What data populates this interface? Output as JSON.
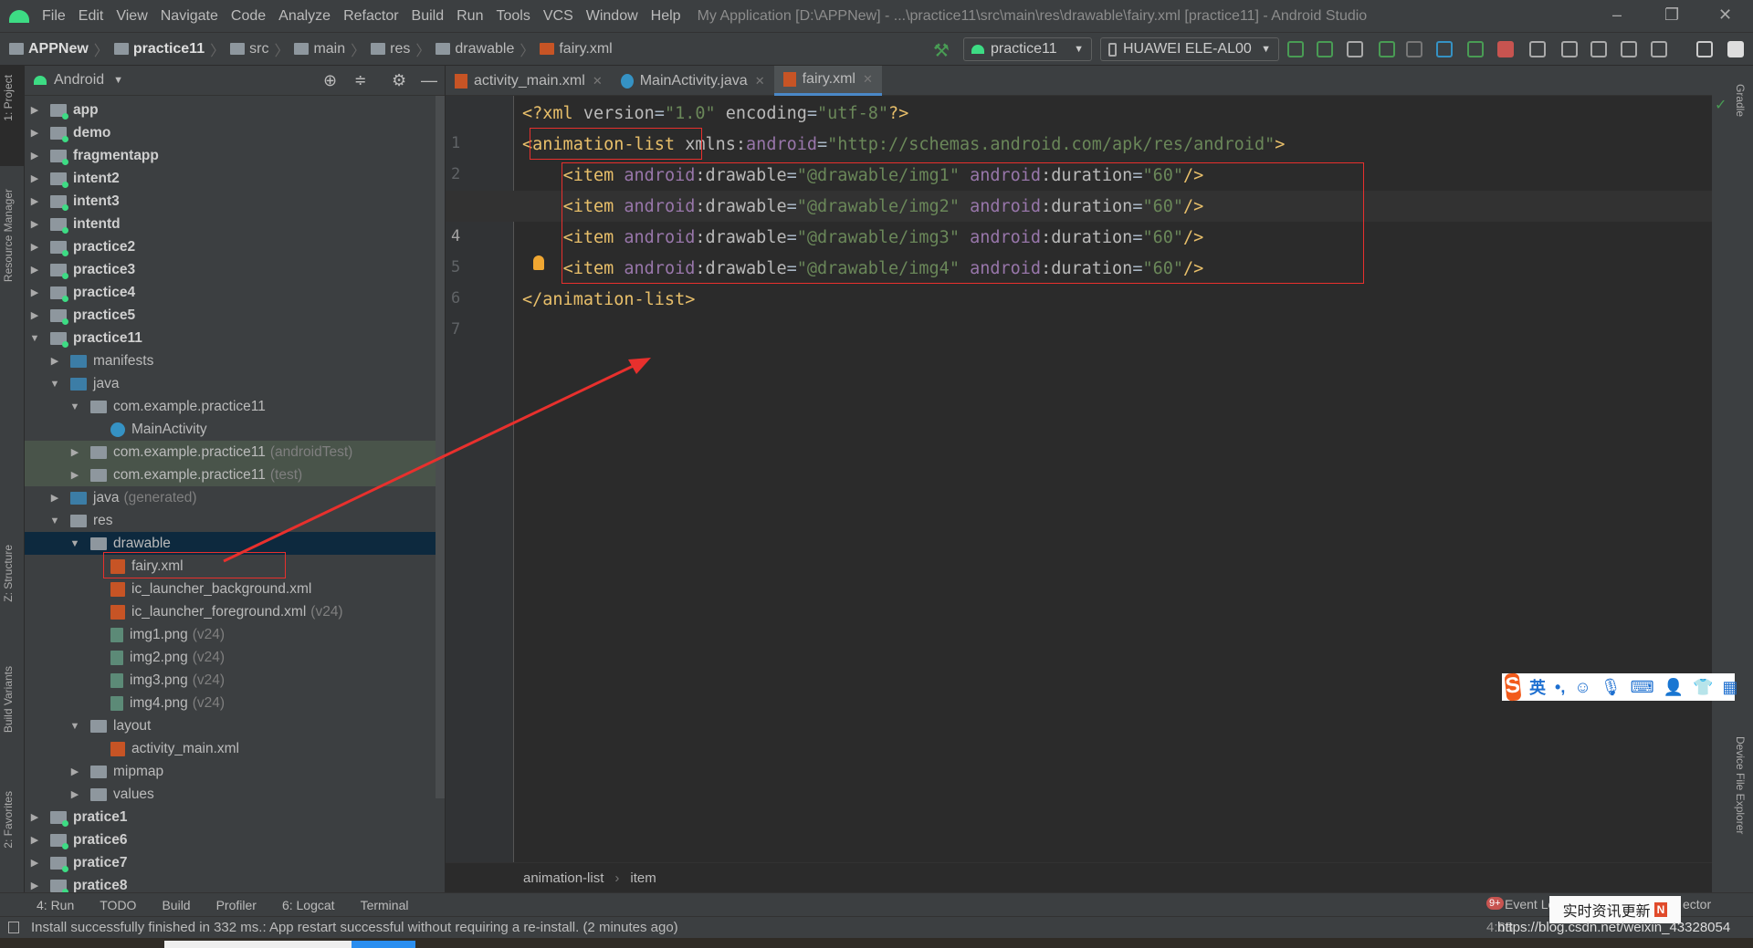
{
  "menubar": {
    "items": [
      "File",
      "Edit",
      "View",
      "Navigate",
      "Code",
      "Analyze",
      "Refactor",
      "Build",
      "Run",
      "Tools",
      "VCS",
      "Window",
      "Help"
    ],
    "window_title": "My Application [D:\\APPNew] - ...\\practice11\\src\\main\\res\\drawable\\fairy.xml [practice11] - Android Studio",
    "controls": {
      "minimize": "–",
      "restore": "❐",
      "close": "✕"
    }
  },
  "breadcrumb": [
    {
      "label": "APPNew",
      "bold": true
    },
    {
      "label": "practice11",
      "bold": true
    },
    {
      "label": "src"
    },
    {
      "label": "main"
    },
    {
      "label": "res"
    },
    {
      "label": "drawable"
    },
    {
      "label": "fairy.xml"
    }
  ],
  "toolbar": {
    "run_config": "practice11",
    "device": "HUAWEI ELE-AL00",
    "icons": [
      "hammer-icon",
      "apply-changes-icon",
      "apply-code-changes-icon",
      "coverage-icon",
      "debug-icon",
      "attach-debugger-icon",
      "profiler-icon",
      "attach-icon",
      "stop-icon",
      "project-structure-icon",
      "avd-manager-icon",
      "sync-gradle-icon",
      "device-manager-icon",
      "sdk-manager-icon",
      "search-icon",
      "user-icon"
    ],
    "icon_colors": {
      "green": "#499c54",
      "red": "#c75450",
      "blue": "#3592c4"
    }
  },
  "left_strip": {
    "tabs": [
      "1: Project",
      "Resource Manager",
      "Z: Structure",
      "Build Variants",
      "2: Favorites"
    ]
  },
  "project": {
    "view": "Android",
    "tree": [
      {
        "depth": 0,
        "kind": "module",
        "label": "app",
        "state": "collapsed"
      },
      {
        "depth": 0,
        "kind": "module",
        "label": "demo",
        "state": "collapsed"
      },
      {
        "depth": 0,
        "kind": "module",
        "label": "fragmentapp",
        "state": "collapsed"
      },
      {
        "depth": 0,
        "kind": "module",
        "label": "intent2",
        "state": "collapsed"
      },
      {
        "depth": 0,
        "kind": "module",
        "label": "intent3",
        "state": "collapsed"
      },
      {
        "depth": 0,
        "kind": "module",
        "label": "intentd",
        "state": "collapsed"
      },
      {
        "depth": 0,
        "kind": "module",
        "label": "practice2",
        "state": "collapsed"
      },
      {
        "depth": 0,
        "kind": "module",
        "label": "practice3",
        "state": "collapsed"
      },
      {
        "depth": 0,
        "kind": "module",
        "label": "practice4",
        "state": "collapsed"
      },
      {
        "depth": 0,
        "kind": "module",
        "label": "practice5",
        "state": "collapsed"
      },
      {
        "depth": 0,
        "kind": "module",
        "label": "practice11",
        "state": "expanded"
      },
      {
        "depth": 1,
        "kind": "src",
        "label": "manifests",
        "state": "collapsed"
      },
      {
        "depth": 1,
        "kind": "src",
        "label": "java",
        "state": "expanded"
      },
      {
        "depth": 2,
        "kind": "pkg",
        "label": "com.example.practice11",
        "state": "expanded"
      },
      {
        "depth": 3,
        "kind": "cls",
        "label": "MainActivity"
      },
      {
        "depth": 2,
        "kind": "pkg",
        "label": "com.example.practice11",
        "suffix": "(androidTest)",
        "state": "collapsed",
        "test": true
      },
      {
        "depth": 2,
        "kind": "pkg",
        "label": "com.example.practice11",
        "suffix": "(test)",
        "state": "collapsed",
        "test": true
      },
      {
        "depth": 1,
        "kind": "src",
        "label": "java",
        "suffix": "(generated)",
        "state": "collapsed"
      },
      {
        "depth": 1,
        "kind": "res",
        "label": "res",
        "state": "expanded"
      },
      {
        "depth": 2,
        "kind": "pkg",
        "label": "drawable",
        "state": "expanded",
        "selected": true
      },
      {
        "depth": 3,
        "kind": "xml",
        "label": "fairy.xml"
      },
      {
        "depth": 3,
        "kind": "xml",
        "label": "ic_launcher_background.xml"
      },
      {
        "depth": 3,
        "kind": "xml",
        "label": "ic_launcher_foreground.xml",
        "suffix": "(v24)"
      },
      {
        "depth": 3,
        "kind": "png",
        "label": "img1.png",
        "suffix": "(v24)"
      },
      {
        "depth": 3,
        "kind": "png",
        "label": "img2.png",
        "suffix": "(v24)"
      },
      {
        "depth": 3,
        "kind": "png",
        "label": "img3.png",
        "suffix": "(v24)"
      },
      {
        "depth": 3,
        "kind": "png",
        "label": "img4.png",
        "suffix": "(v24)"
      },
      {
        "depth": 2,
        "kind": "pkg",
        "label": "layout",
        "state": "expanded"
      },
      {
        "depth": 3,
        "kind": "xml",
        "label": "activity_main.xml"
      },
      {
        "depth": 2,
        "kind": "pkg",
        "label": "mipmap",
        "state": "collapsed"
      },
      {
        "depth": 2,
        "kind": "pkg",
        "label": "values",
        "state": "collapsed"
      },
      {
        "depth": 0,
        "kind": "module",
        "label": "pratice1",
        "state": "collapsed"
      },
      {
        "depth": 0,
        "kind": "module",
        "label": "pratice6",
        "state": "collapsed"
      },
      {
        "depth": 0,
        "kind": "module",
        "label": "pratice7",
        "state": "collapsed"
      },
      {
        "depth": 0,
        "kind": "module",
        "label": "pratice8",
        "state": "collapsed"
      }
    ]
  },
  "editor": {
    "tabs": [
      {
        "label": "activity_main.xml",
        "kind": "xml"
      },
      {
        "label": "MainActivity.java",
        "kind": "java"
      },
      {
        "label": "fairy.xml",
        "kind": "xml",
        "active": true
      }
    ],
    "current_line": 4,
    "lines": [
      [
        [
          "tag",
          "<?xml "
        ],
        [
          "attr",
          "version"
        ],
        [
          "text",
          "="
        ],
        [
          "str",
          "\"1.0\""
        ],
        [
          "attr",
          " encoding"
        ],
        [
          "text",
          "="
        ],
        [
          "str",
          "\"utf-8\""
        ],
        [
          "tag",
          "?>"
        ]
      ],
      [
        [
          "tag",
          "<animation-list "
        ],
        [
          "attr",
          "xmlns:"
        ],
        [
          "ns",
          "android"
        ],
        [
          "text",
          "="
        ],
        [
          "str",
          "\"http://schemas.android.com/apk/res/android\""
        ],
        [
          "tag",
          ">"
        ]
      ],
      [
        [
          "text",
          "    "
        ],
        [
          "tag",
          "<item "
        ],
        [
          "ns",
          "android"
        ],
        [
          "attr",
          ":drawable"
        ],
        [
          "text",
          "="
        ],
        [
          "str",
          "\"@drawable/img1\""
        ],
        [
          "ns",
          " android"
        ],
        [
          "attr",
          ":duration"
        ],
        [
          "text",
          "="
        ],
        [
          "str",
          "\"60\""
        ],
        [
          "tag",
          "/>"
        ]
      ],
      [
        [
          "text",
          "    "
        ],
        [
          "tag",
          "<item "
        ],
        [
          "ns",
          "android"
        ],
        [
          "attr",
          ":drawable"
        ],
        [
          "text",
          "="
        ],
        [
          "str",
          "\"@drawable/img2\""
        ],
        [
          "ns",
          " android"
        ],
        [
          "attr",
          ":duration"
        ],
        [
          "text",
          "="
        ],
        [
          "str",
          "\"60\""
        ],
        [
          "tag",
          "/>"
        ]
      ],
      [
        [
          "text",
          "    "
        ],
        [
          "tag",
          "<item "
        ],
        [
          "ns",
          "android"
        ],
        [
          "attr",
          ":drawable"
        ],
        [
          "text",
          "="
        ],
        [
          "str",
          "\"@drawable/img3\""
        ],
        [
          "ns",
          " android"
        ],
        [
          "attr",
          ":duration"
        ],
        [
          "text",
          "="
        ],
        [
          "str",
          "\"60\""
        ],
        [
          "tag",
          "/>"
        ]
      ],
      [
        [
          "text",
          "    "
        ],
        [
          "tag",
          "<item "
        ],
        [
          "ns",
          "android"
        ],
        [
          "attr",
          ":drawable"
        ],
        [
          "text",
          "="
        ],
        [
          "str",
          "\"@drawable/img4\""
        ],
        [
          "ns",
          " android"
        ],
        [
          "attr",
          ":duration"
        ],
        [
          "text",
          "="
        ],
        [
          "str",
          "\"60\""
        ],
        [
          "tag",
          "/>"
        ]
      ],
      [
        [
          "tag",
          "</animation-list>"
        ]
      ]
    ],
    "breadcrumb": [
      "animation-list",
      "item"
    ],
    "colors": {
      "tag": "#e8bf6a",
      "attr": "#bababa",
      "ns": "#9876aa",
      "str": "#6a8759",
      "text": "#a9b7c6",
      "annotation": "#e8302d"
    }
  },
  "right_strip": {
    "tabs": [
      "Gradle",
      "Device File Explorer"
    ]
  },
  "tool_windows": {
    "run": "4: Run",
    "todo": "TODO",
    "build": "Build",
    "profiler": "Profiler",
    "logcat": "6: Logcat",
    "terminal": "Terminal",
    "event_log": "Event Log",
    "event_badge": "9+",
    "layout_inspector": "ector"
  },
  "status": {
    "message": "Install successfully finished in 332 ms.: App restart successful without requiring a re-install. (2 minutes ago)",
    "position": "4:68"
  },
  "overlays": {
    "ime": {
      "logo": "S",
      "lang": "英",
      "punct": "•,"
    },
    "toast": {
      "text": "实时资讯更新",
      "badge": "N"
    },
    "watermark": "https://blog.csdn.net/weixin_43328054"
  }
}
